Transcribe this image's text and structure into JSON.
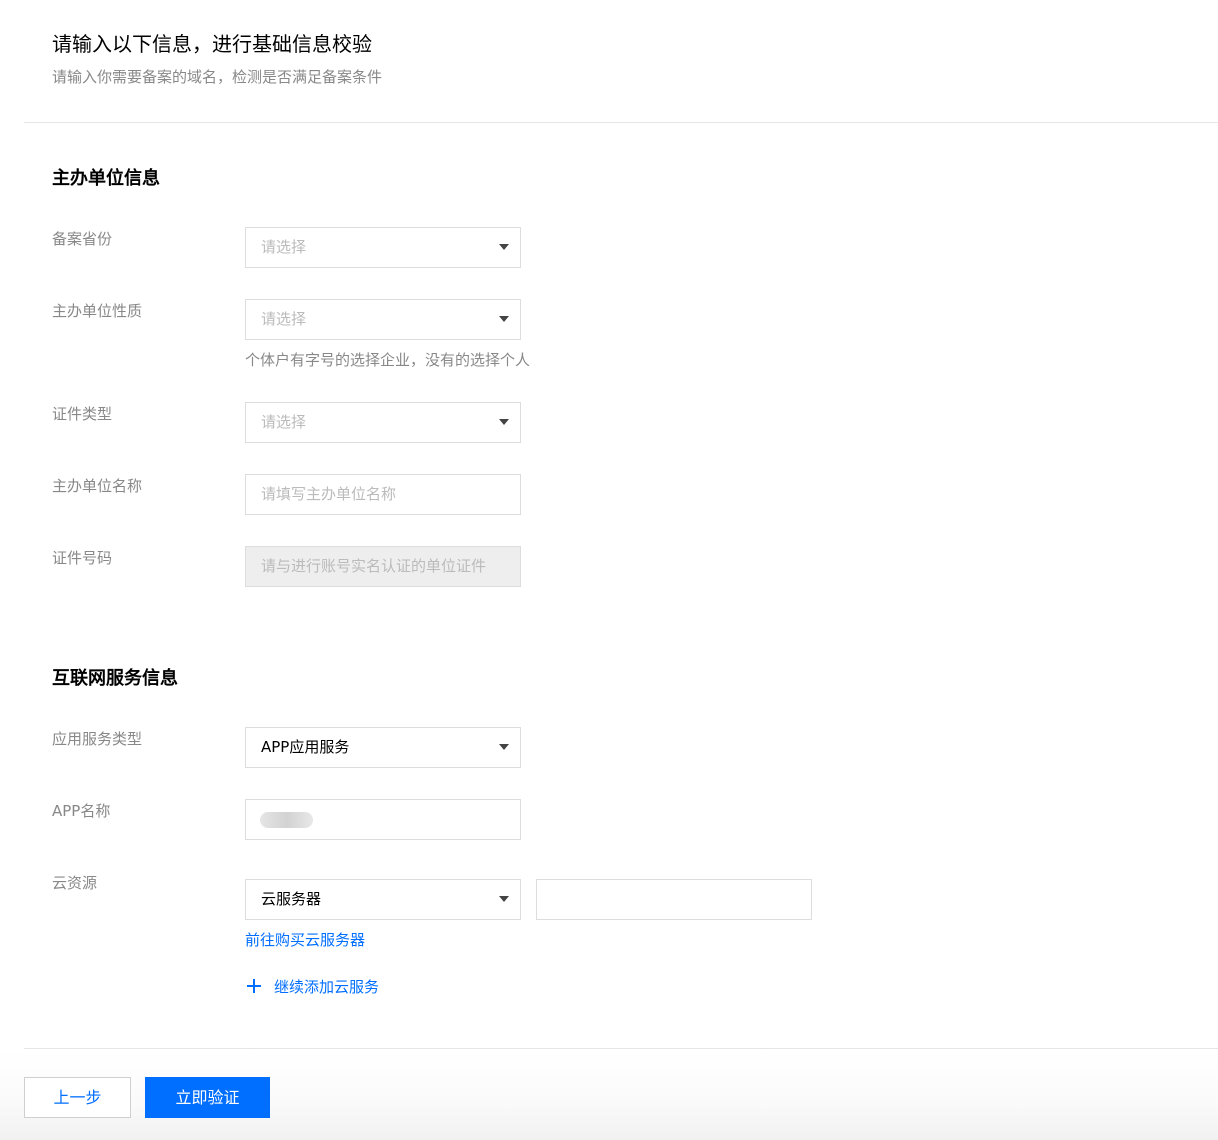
{
  "header": {
    "title": "请输入以下信息，进行基础信息校验",
    "description": "请输入你需要备案的域名，检测是否满足备案条件"
  },
  "sponsor_section": {
    "title": "主办单位信息",
    "province": {
      "label": "备案省份",
      "placeholder": "请选择"
    },
    "nature": {
      "label": "主办单位性质",
      "placeholder": "请选择",
      "help": "个体户有字号的选择企业，没有的选择个人"
    },
    "cert_type": {
      "label": "证件类型",
      "placeholder": "请选择"
    },
    "org_name": {
      "label": "主办单位名称",
      "placeholder": "请填写主办单位名称"
    },
    "cert_number": {
      "label": "证件号码",
      "placeholder": "请与进行账号实名认证的单位证件"
    }
  },
  "internet_section": {
    "title": "互联网服务信息",
    "service_type": {
      "label": "应用服务类型",
      "value": "APP应用服务"
    },
    "app_name": {
      "label": "APP名称"
    },
    "cloud_resource": {
      "label": "云资源",
      "value": "云服务器",
      "buy_link": "前往购买云服务器",
      "add_link": "继续添加云服务"
    }
  },
  "footer": {
    "prev_label": "上一步",
    "verify_label": "立即验证"
  },
  "colors": {
    "accent": "#006eff",
    "label": "#888888",
    "placeholder": "#bbbbbb",
    "border": "#dddddd"
  },
  "icons": {
    "select_caret": "caret-down-icon",
    "add": "plus-icon"
  }
}
